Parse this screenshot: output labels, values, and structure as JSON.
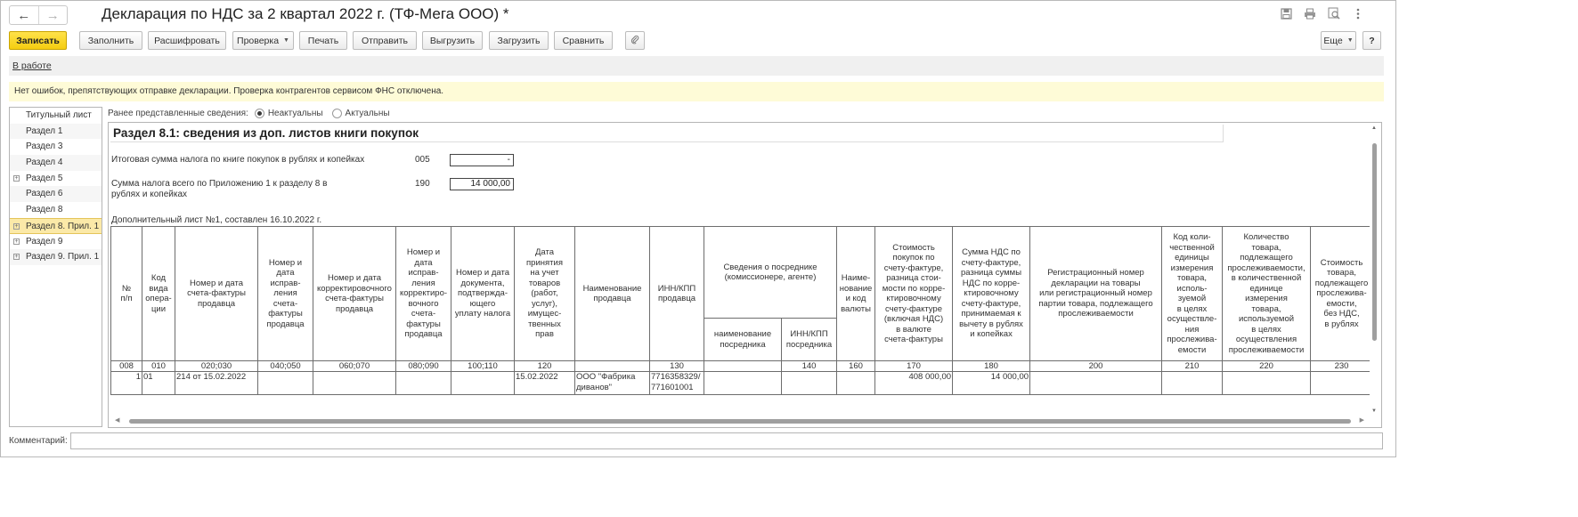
{
  "window": {
    "title": "Декларация по НДС за 2 квартал 2022 г. (ТФ-Мега ООО) *",
    "nav_back": "←",
    "nav_forward": "→",
    "icons": [
      "save-icon",
      "print-icon",
      "preview-icon",
      "more-vertical-icon"
    ]
  },
  "toolbar": {
    "save": "Записать",
    "fill": "Заполнить",
    "decode": "Расшифровать",
    "check": "Проверка",
    "print": "Печать",
    "send": "Отправить",
    "export": "Выгрузить",
    "import": "Загрузить",
    "compare": "Сравнить",
    "attach_icon": "paperclip-icon",
    "more": "Еще",
    "help": "?"
  },
  "status": {
    "link": "В работе"
  },
  "info_message": "Нет ошибок, препятствующих отправке декларации. Проверка контрагентов сервисом ФНС отключена.",
  "sections": [
    {
      "label": "Титульный лист",
      "expandable": false,
      "active": false
    },
    {
      "label": "Раздел 1",
      "expandable": false,
      "active": false
    },
    {
      "label": "Раздел 3",
      "expandable": false,
      "active": false
    },
    {
      "label": "Раздел 4",
      "expandable": false,
      "active": false
    },
    {
      "label": "Раздел 5",
      "expandable": true,
      "active": false
    },
    {
      "label": "Раздел 6",
      "expandable": false,
      "active": false
    },
    {
      "label": "Раздел 8",
      "expandable": false,
      "active": false
    },
    {
      "label": "Раздел 8. Прил. 1",
      "expandable": true,
      "active": true
    },
    {
      "label": "Раздел 9",
      "expandable": true,
      "active": false
    },
    {
      "label": "Раздел 9. Прил. 1",
      "expandable": true,
      "active": false
    }
  ],
  "previous_info": {
    "label": "Ранее представленные сведения:",
    "options": [
      {
        "label": "Неактуальны",
        "checked": true
      },
      {
        "label": "Актуальны",
        "checked": false
      }
    ]
  },
  "report": {
    "heading": "Раздел 8.1: сведения из доп. листов книги покупок",
    "line1": {
      "label": "Итоговая сумма налога по книге покупок в рублях и копейках",
      "code": "005",
      "value": "-"
    },
    "line2": {
      "label_1": "Сумма налога всего по Приложению 1 к разделу 8 в",
      "label_2": "рублях и копейках",
      "code": "190",
      "value": "14 000,00"
    },
    "sheet_caption": "Дополнительный лист №1, составлен 16.10.2022 г.",
    "columns": [
      {
        "label": "№\nп/п",
        "code": "008"
      },
      {
        "label": "Код\nвида\nопера-\nции",
        "code": "010"
      },
      {
        "label": "Номер и дата\nсчета-фактуры\nпродавца",
        "code": "020;030"
      },
      {
        "label": "Номер и\nдата\nисправ-\nления\nсчета-\nфактуры\nпродавца",
        "code": "040;050"
      },
      {
        "label": "Номер и дата\nкорректировочного\nсчета-фактуры\nпродавца",
        "code": "060;070"
      },
      {
        "label": "Номер и\nдата\nисправ-\nления\nкорректиро-\nвочного\nсчета-\nфактуры\nпродавца",
        "code": "080;090"
      },
      {
        "label": "Номер и дата\nдокумента,\nподтвержда-\nющего\nуплату налога",
        "code": "100;110"
      },
      {
        "label": "Дата\nпринятия\nна учет\nтоваров\n(работ,\nуслуг),\nимущес-\nтвенных\nправ",
        "code": "120"
      },
      {
        "label": "Наименование\nпродавца",
        "code": ""
      },
      {
        "label": "ИНН/КПП\nпродавца",
        "code": "130"
      },
      {
        "label": "наименование\nпосредника",
        "code": ""
      },
      {
        "label": "ИНН/КПП\nпосредника",
        "code": "140"
      },
      {
        "label": "Наиме-\nнование\nи код\nвалюты",
        "code": "160"
      },
      {
        "label": "Стоимость\nпокупок по\nсчету-фактуре,\nразница стои-\nмости по корре-\nктировочному\nсчету-фактуре\n(включая НДС)\nв валюте\nсчета-фактуры",
        "code": "170"
      },
      {
        "label": "Сумма НДС по\nсчету-фактуре,\nразница суммы\nНДС по корре-\nктировочному\nсчету-фактуре,\nпринимаемая к\nвычету в рублях\nи копейках",
        "code": "180"
      },
      {
        "label": "Регистрационный номер\nдекларации на товары\nили регистрационный номер\nпартии товара, подлежащего\nпрослеживаемости",
        "code": "200"
      },
      {
        "label": "Код коли-\nчественной\nединицы\nизмерения\nтовара,\nисполь-\nзуемой\nв целях\nосуществле-\nния\nпрослежива-\nемости",
        "code": "210"
      },
      {
        "label": "Количество\nтовара,\nподлежащего\nпрослеживаемости,\nв количественной\nединице\nизмерения\nтовара,\nиспользуемой\nв целях\nосуществления\nпрослеживаемости",
        "code": "220"
      },
      {
        "label": "Стоимость\nтовара,\nподлежащего\nпрослежива-\nемости,\nбез НДС,\nв рублях",
        "code": "230"
      }
    ],
    "intermediary_group": "Сведения о посреднике\n(комиссионере, агенте)",
    "rows": [
      [
        "1",
        "01",
        "214 от 15.02.2022",
        "",
        "",
        "",
        "",
        "15.02.2022",
        "ООО \"Фабрика\nдиванов\"",
        "7716358329/\n771601001",
        "",
        "",
        "",
        "408 000,00",
        "14 000,00",
        "",
        "",
        "",
        ""
      ]
    ]
  },
  "comment": {
    "label": "Комментарий:",
    "value": ""
  }
}
